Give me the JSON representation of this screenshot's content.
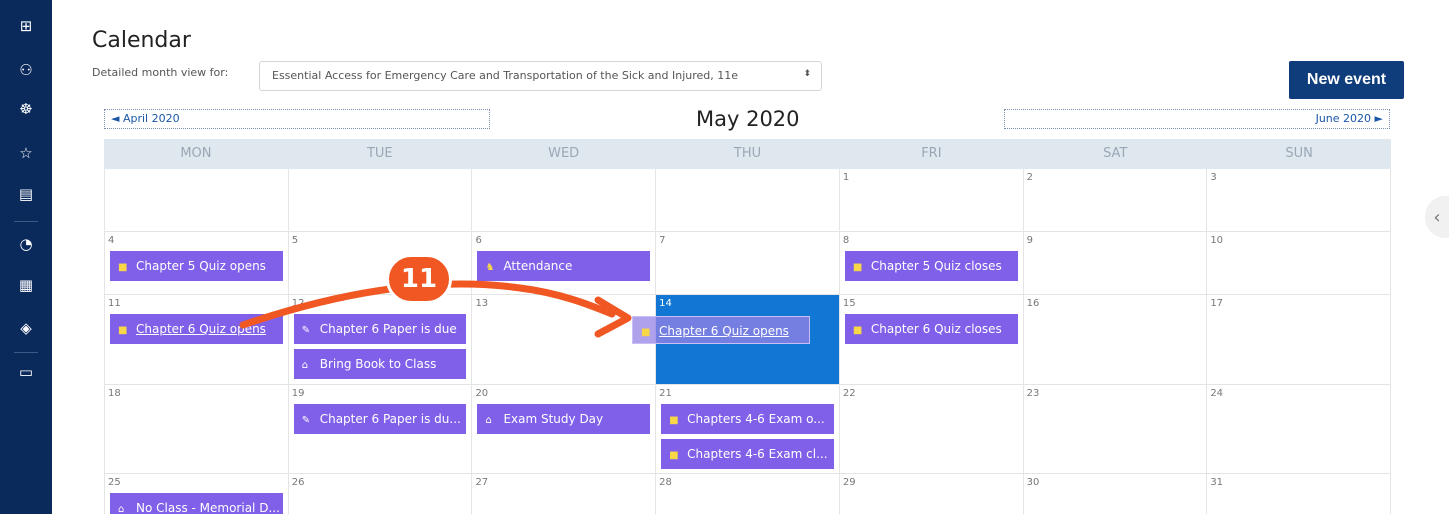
{
  "sidebar": {
    "icons": [
      {
        "name": "dashboard-grid-icon",
        "glyph": "⊞"
      },
      {
        "name": "participants-icon",
        "glyph": "⚇"
      },
      {
        "name": "badges-icon",
        "glyph": "☸"
      },
      {
        "name": "competencies-star-icon",
        "glyph": "☆"
      },
      {
        "name": "grades-icon",
        "glyph": "▤"
      },
      {
        "name": "dashboard-gauge-icon",
        "glyph": "◔"
      },
      {
        "name": "calendar-icon",
        "glyph": "▦"
      },
      {
        "name": "courses-icon",
        "glyph": "◈"
      },
      {
        "name": "folder-icon",
        "glyph": "▭"
      }
    ]
  },
  "header": {
    "title": "Calendar",
    "view_label": "Detailed month view for:",
    "course_select": "Essential Access for Emergency Care and Transportation of the Sick and Injured, 11e",
    "select_arrow": "⬍",
    "new_event": "New event"
  },
  "nav": {
    "prev": "◄  April 2020",
    "next": "June 2020  ►",
    "month": "May 2020"
  },
  "weekdays": [
    "MON",
    "TUE",
    "WED",
    "THU",
    "FRI",
    "SAT",
    "SUN"
  ],
  "weeks": [
    {
      "days": [
        "",
        "",
        "",
        "1",
        "2",
        "3",
        ""
      ]
    },
    {
      "days": [
        "4",
        "5",
        "6",
        "7",
        "8",
        "9",
        "10"
      ]
    },
    {
      "days": [
        "11",
        "12",
        "13",
        "14",
        "15",
        "16",
        "17"
      ]
    },
    {
      "days": [
        "18",
        "19",
        "20",
        "21",
        "22",
        "23",
        "24"
      ]
    },
    {
      "days": [
        "25",
        "26",
        "27",
        "28",
        "29",
        "30",
        "31"
      ]
    }
  ],
  "events": {
    "e1": {
      "title": "Chapter 5 Quiz opens",
      "icon": "quiz-icon"
    },
    "e2": {
      "title": "Attendance",
      "icon": "attendance-icon"
    },
    "e3": {
      "title": "Chapter 5 Quiz closes",
      "icon": "quiz-icon"
    },
    "e4": {
      "title": "Chapter 6 Quiz opens",
      "icon": "quiz-icon"
    },
    "e5": {
      "title": "Chapter 6 Paper is due",
      "icon": "pencil-icon"
    },
    "e6": {
      "title": "Bring Book to Class",
      "icon": "course-event-icon"
    },
    "e7": {
      "title": "Chapter 6 Quiz closes",
      "icon": "quiz-icon"
    },
    "e8": {
      "title": "Chapter 6 Paper is du...",
      "icon": "pencil-icon"
    },
    "e9": {
      "title": "Exam Study Day",
      "icon": "course-event-icon"
    },
    "e10": {
      "title": "Chapters 4-6 Exam o...",
      "icon": "quiz-icon"
    },
    "e11": {
      "title": "Chapters 4-6 Exam cl...",
      "icon": "quiz-icon"
    },
    "e12": {
      "title": "No Class - Memorial D...",
      "icon": "course-event-icon"
    },
    "ghost": {
      "title": "Chapter 6 Quiz opens",
      "icon": "quiz-icon"
    }
  },
  "glyphs": {
    "quiz": "■",
    "pencil": "✎",
    "cap": "⌂",
    "attend": "♞"
  },
  "annotation": {
    "step": "11",
    "color": "#f05722"
  },
  "colors": {
    "sidebar": "#0b2a5c",
    "event": "#8060e8",
    "today": "#1277d4",
    "button": "#0f3c7a"
  },
  "collapse_glyph": "‹"
}
